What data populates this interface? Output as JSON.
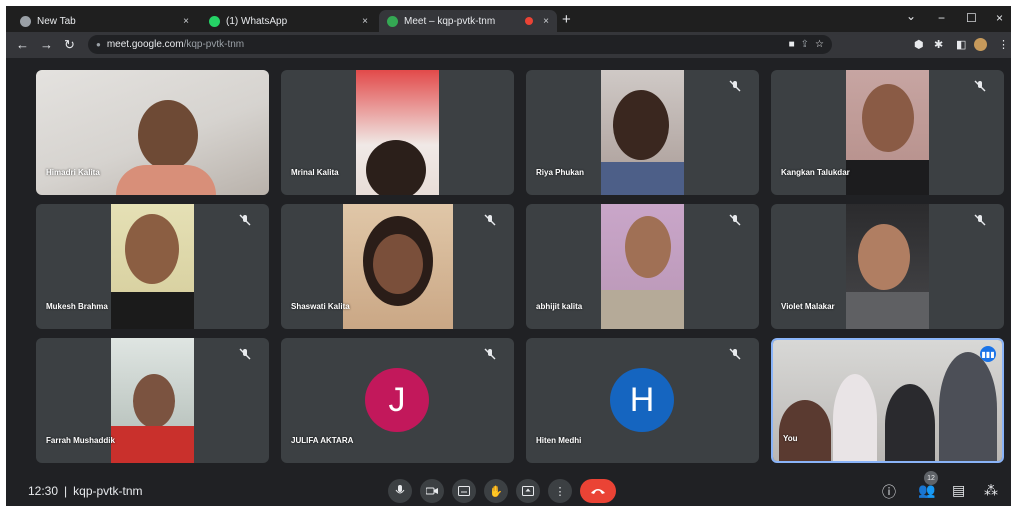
{
  "browser": {
    "tabs": [
      {
        "label": "New Tab",
        "close": "×",
        "favicon_color": "#9aa0a6"
      },
      {
        "label": "(1) WhatsApp",
        "close": "×",
        "favicon_color": "#25d366"
      },
      {
        "label": "Meet – kqp-pvtk-tnm",
        "close": "×",
        "favicon_color": "#34a853",
        "recording_dot_color": "#ea4335"
      }
    ],
    "new_tab": "+",
    "window_controls": {
      "minimize": "−",
      "maximize": "☐",
      "close": "×",
      "chevron": "⌄"
    },
    "address": {
      "host": "meet.google.com",
      "path": "/kqp-pvtk-tnm"
    }
  },
  "meeting": {
    "participants": [
      {
        "name": "Himadri Kalita",
        "muted": false
      },
      {
        "name": "Mrinal Kalita",
        "muted": false
      },
      {
        "name": "Riya Phukan",
        "muted": true
      },
      {
        "name": "Kangkan Talukdar",
        "muted": true
      },
      {
        "name": "Mukesh Brahma",
        "muted": true
      },
      {
        "name": "Shaswati Kalita",
        "muted": true
      },
      {
        "name": "abhijit kalita",
        "muted": true
      },
      {
        "name": "Violet Malakar",
        "muted": true
      },
      {
        "name": "Farrah Mushaddik",
        "muted": true
      },
      {
        "name": "JULIFA AKTARA",
        "muted": true,
        "initial": "J",
        "avatar_color": "#c2185b"
      },
      {
        "name": "Hiten Medhi",
        "muted": true,
        "initial": "H",
        "avatar_color": "#1565c0"
      },
      {
        "name": "You",
        "muted": false
      }
    ],
    "time": "12:30",
    "separator": "|",
    "code": "kqp-pvtk-tnm",
    "participant_count": "12"
  }
}
